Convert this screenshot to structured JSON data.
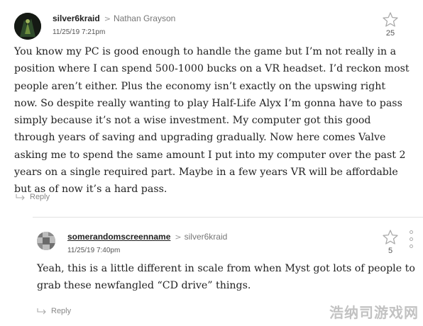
{
  "comments": [
    {
      "author": "silver6kraid",
      "reply_to": "Nathan Grayson",
      "timestamp": "11/25/19 7:21pm",
      "stars": "25",
      "body": "You know my PC is good enough to handle the game but I’m not really in a position where I can spend 500-1000 bucks on a VR headset. I’d reckon most people aren’t either. Plus the economy isn’t exactly on the upswing right now. So despite really wanting to play Half-Life Alyx I’m gonna have to pass simply because it’s not a wise investment. My computer got this good through years of saving and upgrading gradually. Now here comes Valve asking me to spend the same amount I put into my computer over the past 2 years on a single required part. Maybe in a few years VR will be affordable but as of now it’s a hard pass.",
      "reply_label": "Reply"
    },
    {
      "author": "somerandomscreenname",
      "reply_to": "silver6kraid",
      "timestamp": "11/25/19 7:40pm",
      "stars": "5",
      "body": "Yeah, this is a little different in scale from when Myst got lots of people to grab these newfangled “CD drive” things.",
      "reply_label": "Reply"
    }
  ],
  "icons": {
    "star": "star-outline-icon",
    "more": "vertical-dots-icon",
    "reply": "reply-arrow-icon",
    "reply_separator": "chevron-right-icon"
  },
  "colors": {
    "text": "#222222",
    "meta": "#777777",
    "divider": "#e2e2e2"
  },
  "watermark": "浩纳司游戏网"
}
